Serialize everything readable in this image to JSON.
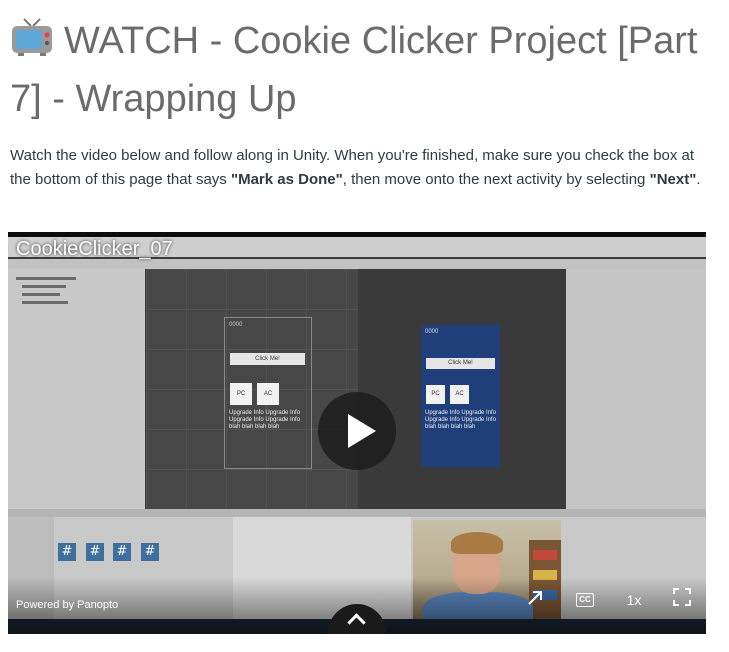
{
  "page": {
    "title": "WATCH - Cookie Clicker Project [Part 7] - Wrapping Up",
    "intro": {
      "before_mark": "Watch the video below and follow along in Unity. When you're finished, make sure you check the box at the bottom of this page that says ",
      "mark_label": "\"Mark as Done\"",
      "between": ", then move onto the next activity by selecting ",
      "next_label": "\"Next\"",
      "after": "."
    }
  },
  "video": {
    "title": "CookieClicker_07",
    "powered_by": "Powered by Panopto",
    "speed": "1x",
    "cc_label": "CC",
    "mockup": {
      "counter": "0000",
      "click_button": "Click Me!",
      "pc_label": "PC",
      "ac_label": "AC",
      "upgrade_text": "Upgrade Info Upgrade Info Upgrade Info Upgrade Info blah blah blah blah"
    },
    "assets": [
      "#",
      "#",
      "#",
      "#"
    ]
  },
  "colors": {
    "title": "#6b6b6b",
    "body_text": "#2d3b45",
    "player_bg": "#0c0c0c",
    "game_panel": "#1f3f7a"
  },
  "icons": {
    "title_icon": "television-icon",
    "play": "play-icon",
    "share": "open-external-icon",
    "cc": "closed-captions-icon",
    "fullscreen": "fullscreen-icon",
    "expand": "chevron-up-icon"
  }
}
